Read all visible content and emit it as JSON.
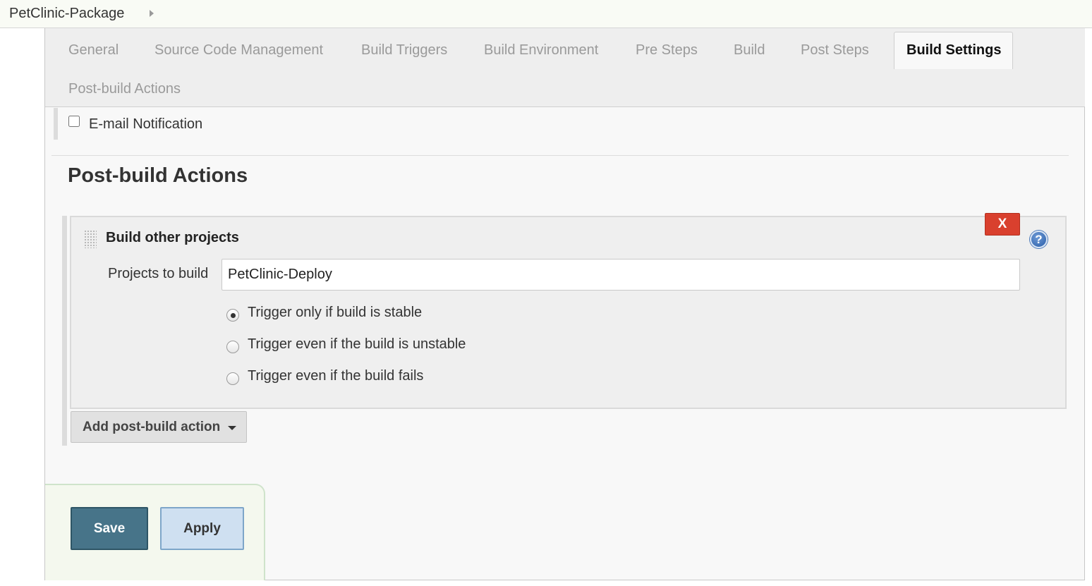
{
  "breadcrumb": {
    "project": "PetClinic-Package"
  },
  "tabs": [
    {
      "label": "General"
    },
    {
      "label": "Source Code Management"
    },
    {
      "label": "Build Triggers"
    },
    {
      "label": "Build Environment"
    },
    {
      "label": "Pre Steps"
    },
    {
      "label": "Build"
    },
    {
      "label": "Post Steps"
    },
    {
      "label": "Build Settings",
      "active": true
    },
    {
      "label": "Post-build Actions"
    }
  ],
  "build_settings": {
    "email_notification_label": "E-mail Notification",
    "email_notification_checked": false
  },
  "post_build": {
    "heading": "Post-build Actions",
    "panel": {
      "title": "Build other projects",
      "delete_label": "X",
      "help_glyph": "?",
      "projects_label": "Projects to build",
      "projects_value": "PetClinic-Deploy",
      "options": [
        {
          "label": "Trigger only if build is stable",
          "checked": true
        },
        {
          "label": "Trigger even if the build is unstable",
          "checked": false
        },
        {
          "label": "Trigger even if the build fails",
          "checked": false
        }
      ]
    },
    "add_action_label": "Add post-build action"
  },
  "footer": {
    "save_label": "Save",
    "apply_label": "Apply"
  },
  "icons": {
    "breadcrumb_arrow": "chevron-right-icon",
    "help": "help-icon",
    "drag": "drag-handle-icon",
    "dropdown": "caret-down-icon"
  },
  "colors": {
    "save_button": "#477489",
    "apply_button": "#cfe0f1",
    "delete_button": "#d9402e",
    "help_icon": "#2a5ea8"
  }
}
